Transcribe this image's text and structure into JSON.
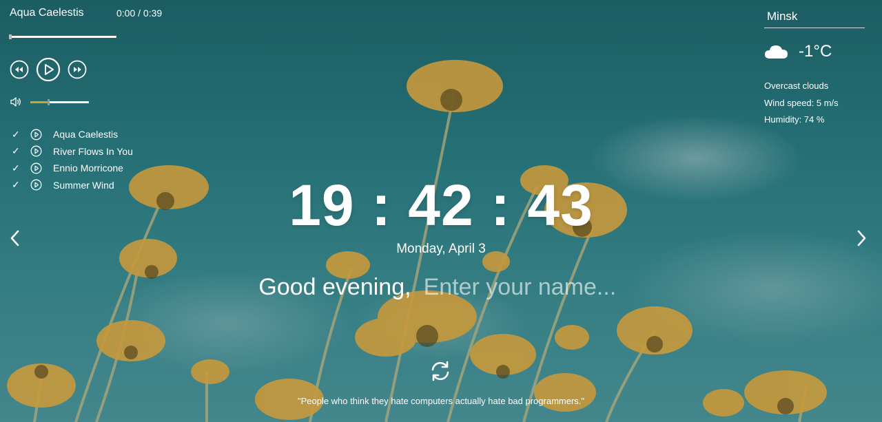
{
  "player": {
    "current_track": "Aqua Caelestis",
    "time": "0:00 / 0:39",
    "progress": 0.0,
    "volume": 0.3,
    "playlist": [
      {
        "title": "Aqua Caelestis"
      },
      {
        "title": "River Flows In You"
      },
      {
        "title": "Ennio Morricone"
      },
      {
        "title": "Summer Wind"
      }
    ]
  },
  "weather": {
    "city": "Minsk",
    "icon": "cloud-icon",
    "temperature": "-1°C",
    "description": "Overcast clouds",
    "wind": "Wind speed: 5 m/s",
    "humidity": "Humidity: 74 %"
  },
  "clock": {
    "time": "19 : 42 : 43",
    "date": "Monday, April 3"
  },
  "greeting": {
    "text": "Good evening,",
    "name_placeholder": "Enter your name...",
    "name_value": ""
  },
  "quote": {
    "text": "\"People who think they hate computers actually hate bad programmers.\""
  },
  "colors": {
    "volume_fill": "#d2a520",
    "background": "#2e7a7f"
  }
}
